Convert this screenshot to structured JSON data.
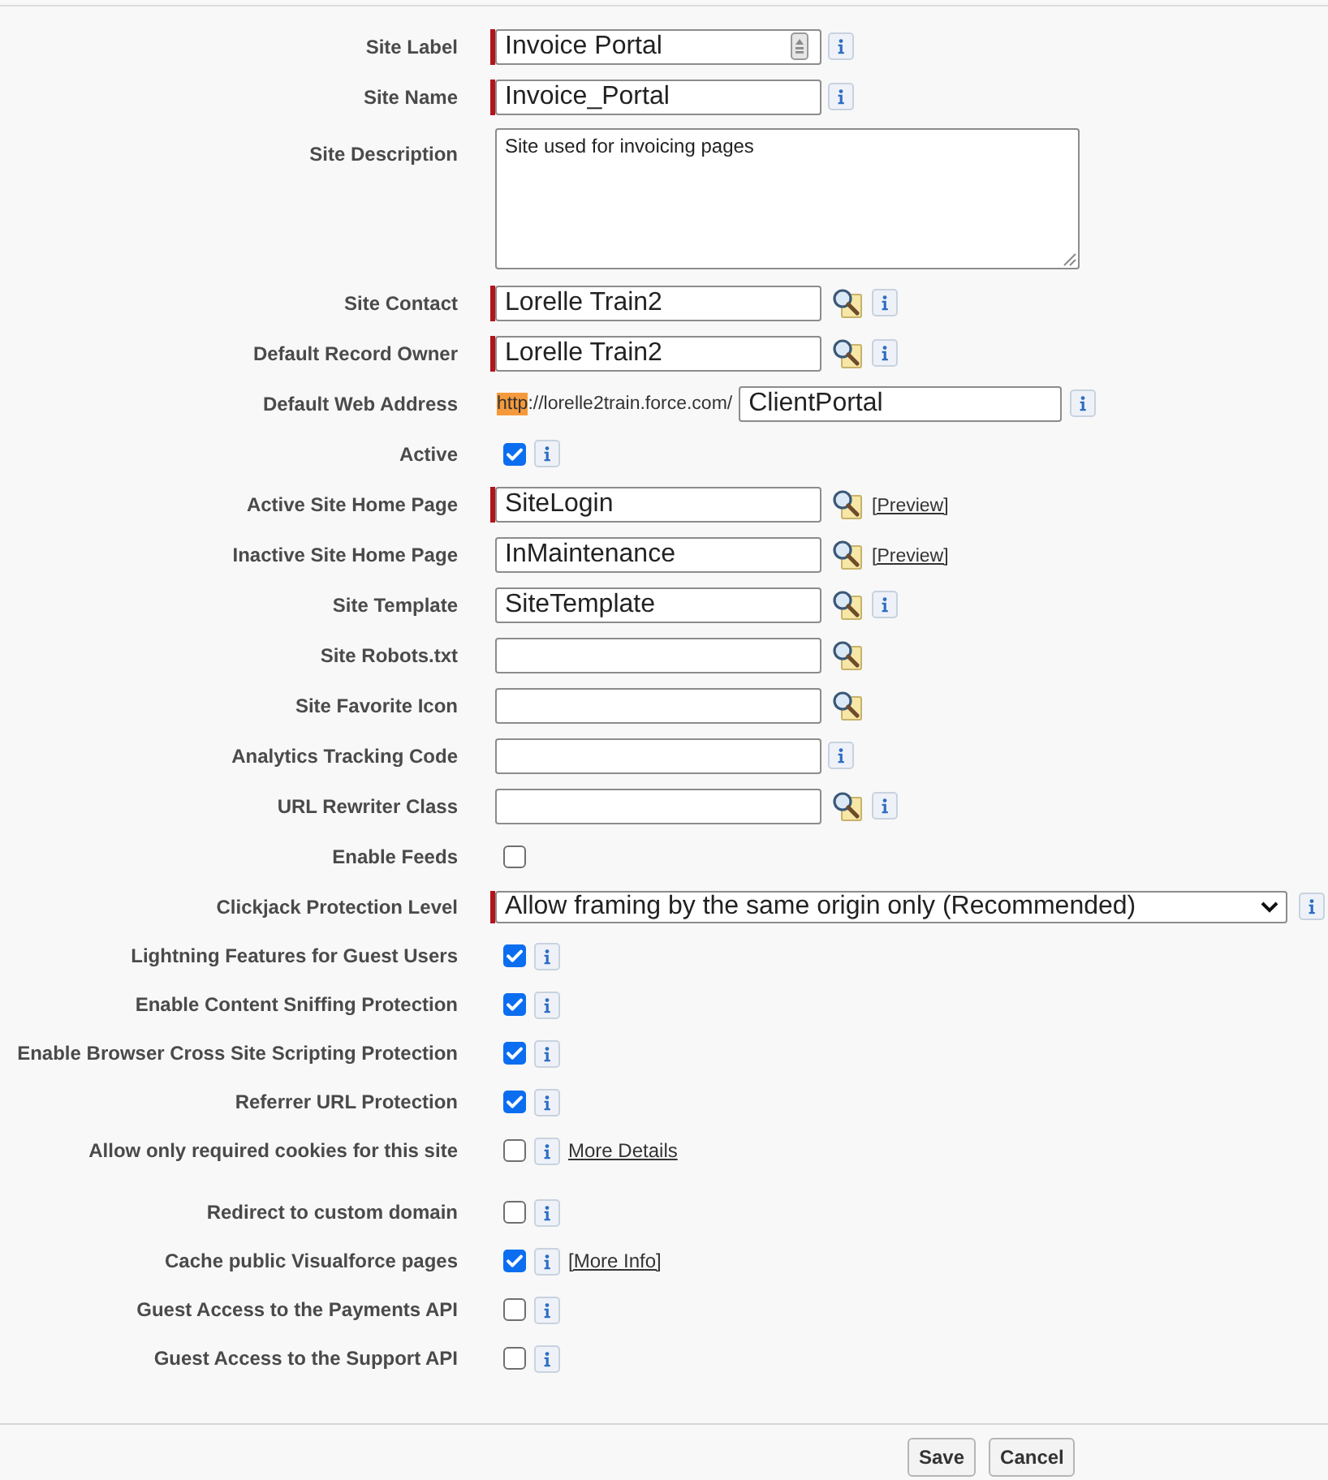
{
  "fields": [
    {
      "label": "Site Label",
      "kind": "text",
      "value": "Invoice Portal",
      "required": true,
      "badge": true,
      "info": true
    },
    {
      "label": "Site Name",
      "kind": "text",
      "value": "Invoice_Portal",
      "required": true,
      "info": true
    },
    {
      "label": "Site Description",
      "kind": "textarea",
      "value": "Site used for invoicing pages"
    },
    {
      "label": "Site Contact",
      "kind": "text",
      "value": "Lorelle Train2",
      "required": true,
      "lookup": true,
      "info": true
    },
    {
      "label": "Default Record Owner",
      "kind": "text",
      "value": "Lorelle Train2",
      "required": true,
      "lookup": true,
      "info": true
    },
    {
      "label": "Default Web Address",
      "kind": "url",
      "scheme": "http",
      "scheme_highlighted": true,
      "host": "://lorelle2train.force.com/",
      "value": "ClientPortal",
      "info": true
    },
    {
      "label": "Active",
      "kind": "checkbox",
      "checked": true,
      "info": true
    },
    {
      "label": "Active Site Home Page",
      "kind": "text",
      "value": "SiteLogin",
      "required": true,
      "lookup": true,
      "link": "[Preview]"
    },
    {
      "label": "Inactive Site Home Page",
      "kind": "text",
      "value": "InMaintenance",
      "required": false,
      "lookup": true,
      "link": "[Preview]"
    },
    {
      "label": "Site Template",
      "kind": "text",
      "value": "SiteTemplate",
      "required": false,
      "lookup": true,
      "info": true
    },
    {
      "label": "Site Robots.txt",
      "kind": "text",
      "required": false,
      "lookup": true
    },
    {
      "label": "Site Favorite Icon",
      "kind": "text",
      "required": false,
      "lookup": true
    },
    {
      "label": "Analytics Tracking Code",
      "kind": "text",
      "required": false,
      "info": true
    },
    {
      "label": "URL Rewriter Class",
      "kind": "text",
      "required": false,
      "lookup": true,
      "info": true
    },
    {
      "label": "Enable Feeds",
      "kind": "checkbox",
      "checked": false
    },
    {
      "label": "Clickjack Protection Level",
      "kind": "select",
      "value": "Allow framing by the same origin only (Recommended)",
      "required": true,
      "info": true
    },
    {
      "label": "Lightning Features for Guest Users",
      "kind": "checkbox",
      "checked": true,
      "info": true
    },
    {
      "label": "Enable Content Sniffing Protection",
      "kind": "checkbox",
      "checked": true,
      "info": true
    },
    {
      "label": "Enable Browser Cross Site Scripting Protection",
      "kind": "checkbox",
      "checked": true,
      "info": true
    },
    {
      "label": "Referrer URL Protection",
      "kind": "checkbox",
      "checked": true,
      "info": true
    },
    {
      "label": "Allow only required cookies for this site",
      "kind": "checkbox",
      "checked": false,
      "info": true,
      "link": "More Details"
    },
    {
      "label": "Redirect to custom domain",
      "kind": "checkbox",
      "checked": false,
      "info": true
    },
    {
      "label": "Cache public Visualforce pages",
      "kind": "checkbox",
      "checked": true,
      "info": true,
      "link": "[More Info]"
    },
    {
      "label": "Guest Access to the Payments API",
      "kind": "checkbox",
      "checked": false,
      "info": true
    },
    {
      "label": "Guest Access to the Support API",
      "kind": "checkbox",
      "checked": false,
      "info": true
    }
  ],
  "buttons": [
    "Save",
    "Cancel"
  ]
}
